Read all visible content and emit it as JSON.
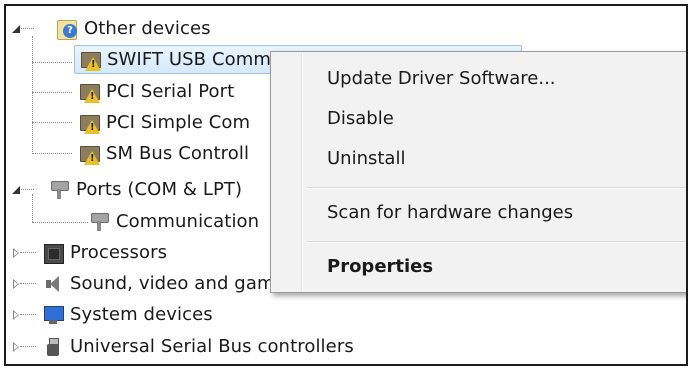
{
  "tree": {
    "other_devices": {
      "label": "Other devices",
      "icon": "unknown-device-icon"
    },
    "other_children": [
      {
        "label": "SWIFT USB Comm",
        "icon": "warning-device-icon"
      },
      {
        "label": "PCI Serial Port",
        "icon": "warning-device-icon"
      },
      {
        "label": "PCI Simple Com",
        "icon": "warning-device-icon"
      },
      {
        "label": "SM Bus Controll",
        "icon": "warning-device-icon"
      }
    ],
    "ports": {
      "label": "Ports (COM & LPT)",
      "icon": "port-icon"
    },
    "ports_children": [
      {
        "label": "Communication",
        "icon": "port-icon"
      }
    ],
    "collapsed": [
      {
        "label": "Processors",
        "icon": "processor-icon"
      },
      {
        "label": "Sound, video and game controllers",
        "icon": "speaker-icon"
      },
      {
        "label": "System devices",
        "icon": "system-device-icon"
      },
      {
        "label": "Universal Serial Bus controllers",
        "icon": "usb-icon"
      }
    ]
  },
  "context_menu": {
    "update_driver": "Update Driver Software...",
    "disable": "Disable",
    "uninstall": "Uninstall",
    "scan": "Scan for hardware changes",
    "properties": "Properties"
  },
  "colors": {
    "selection_bg": "#d6e9fb",
    "selection_border": "#9cc4ea",
    "warning": "#e8c02a",
    "menu_bg": "#f2f2f2"
  }
}
